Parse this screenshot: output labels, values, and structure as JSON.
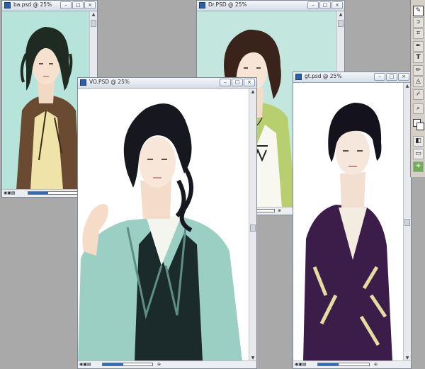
{
  "windows": [
    {
      "id": "ba",
      "title": "ba.psd @ 25%",
      "bg": "#b7e4da"
    },
    {
      "id": "vo",
      "title": "VO.PSD @ 25%",
      "bg": "#ffffff"
    },
    {
      "id": "dr",
      "title": "Dr.PSD @ 25%",
      "bg": "#c3e7df"
    },
    {
      "id": "gt",
      "title": "gt.psd @ 25%",
      "bg": "#ffffff"
    }
  ],
  "colors": {
    "desktop": "#a9a9a9",
    "progress_fill": "#1f6fcf",
    "hair_dark": "#17181f",
    "jacket_brown": "#6b4a32",
    "jacket_mint": "#9ccfc3",
    "cardigan_green": "#b7cf6e",
    "kimono_purple": "#3c1d4a"
  },
  "icons": {
    "window_minimize": "minimize-icon",
    "window_maximize": "maximize-icon",
    "window_close": "close-icon",
    "tool_brush": "brush-icon",
    "tool_lasso": "lasso-icon",
    "tool_crop": "crop-icon",
    "tool_pen": "pen-icon",
    "tool_type": "type-icon",
    "tool_eyedropper": "eyedropper-icon",
    "tool_zoom": "zoom-icon"
  }
}
